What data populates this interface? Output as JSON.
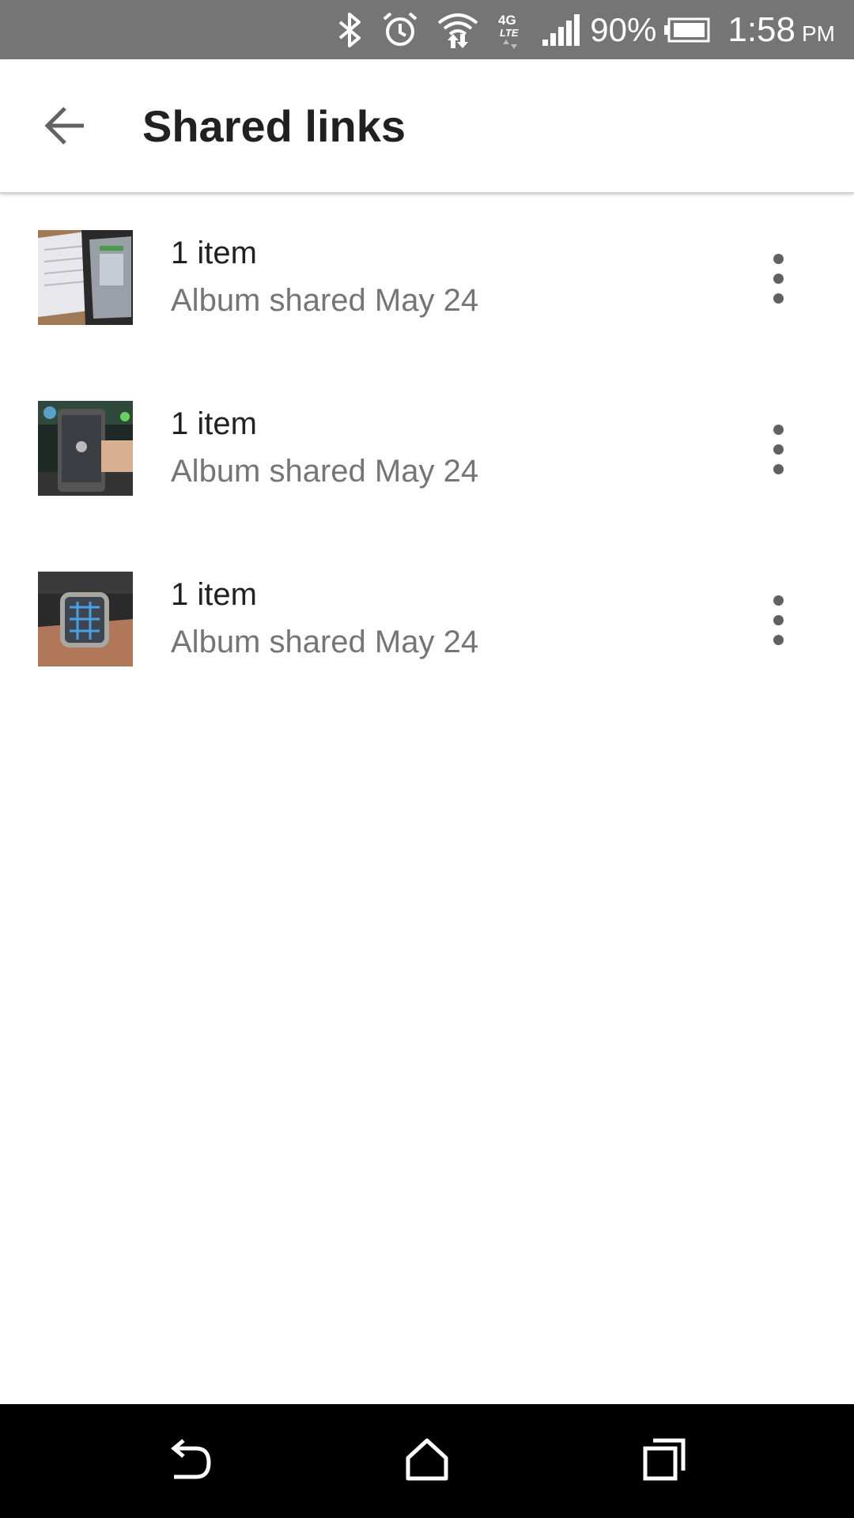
{
  "status_bar": {
    "battery_percent": "90%",
    "time": "1:58",
    "ampm": "PM",
    "icons": [
      "bluetooth-icon",
      "alarm-icon",
      "wifi-icon",
      "4g-lte-icon",
      "signal-icon",
      "battery-icon"
    ]
  },
  "app_bar": {
    "title": "Shared links",
    "back_icon": "arrow-back-icon"
  },
  "list": {
    "items": [
      {
        "title": "1 item",
        "subtitle": "Album shared May 24",
        "thumbnail": "tablet-photo"
      },
      {
        "title": "1 item",
        "subtitle": "Album shared May 24",
        "thumbnail": "phone-photo"
      },
      {
        "title": "1 item",
        "subtitle": "Album shared May 24",
        "thumbnail": "smartwatch-photo"
      }
    ]
  },
  "nav_bar": {
    "icons": [
      "back-icon",
      "home-icon",
      "recents-icon"
    ]
  },
  "colors": {
    "status_bar": "#757575",
    "title_text": "#212121",
    "secondary_text": "#757575",
    "nav_bar": "#000000"
  }
}
